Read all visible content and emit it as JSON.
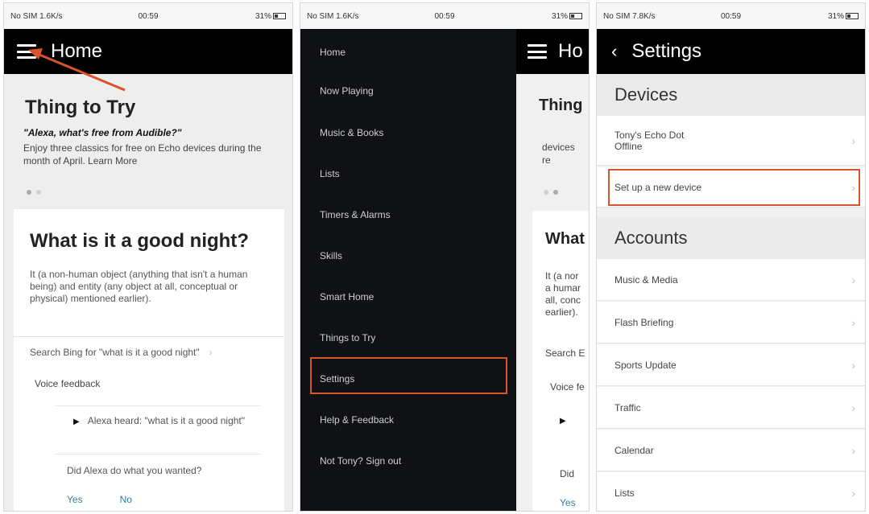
{
  "status": {
    "p1": {
      "carrier": "No SIM 1.6K/s",
      "time": "00:59",
      "battery": "31%"
    },
    "p2": {
      "carrier": "No SIM 1.6K/s",
      "time": "00:59",
      "battery": "31%"
    },
    "p3": {
      "carrier": "No SIM 7.8K/s",
      "time": "00:59",
      "battery": "31%"
    }
  },
  "home": {
    "title": "Home",
    "thing_title": "Thing to Try",
    "thing_quote": "\"Alexa, what's free from Audible?\"",
    "thing_desc": "Enjoy three classics for free on Echo devices during the month of April. Learn More",
    "card_title": "What is it a good night?",
    "card_body": "It (a non-human object (anything that isn't a human being) and entity (any object at all, conceptual or physical) mentioned earlier).",
    "search_text": "Search Bing for \"what is it a good night\"",
    "voice_feedback": "Voice feedback",
    "alexa_heard": "Alexa heard: \"what is it a good night\"",
    "did_alexa": "Did Alexa do what you wanted?",
    "yes": "Yes",
    "no": "No"
  },
  "drawer": {
    "items": [
      "Home",
      "Now Playing",
      "Music & Books",
      "Lists",
      "Timers & Alarms",
      "Skills",
      "Smart Home",
      "Things to Try",
      "Settings",
      "Help & Feedback",
      "Not Tony? Sign out"
    ],
    "peek_title": "Ho",
    "peek_thing": "Thing",
    "peek_devices": "devices",
    "peek_re": "re",
    "peek_what": "What",
    "peek_body": [
      "It (a nor",
      "a humar",
      "all, conc",
      "earlier)."
    ],
    "peek_search": "Search E",
    "peek_voice": "Voice fe",
    "peek_did": "Did",
    "peek_yes": "Yes"
  },
  "settings": {
    "title": "Settings",
    "devices_header": "Devices",
    "device_name": "Tony's Echo Dot",
    "device_status": "Offline",
    "new_device": "Set up a new device",
    "accounts_header": "Accounts",
    "accounts": [
      "Music & Media",
      "Flash Briefing",
      "Sports Update",
      "Traffic",
      "Calendar",
      "Lists"
    ]
  },
  "colors": {
    "appbar": "#000000",
    "highlight": "#d9542b",
    "link": "#2e7fa0",
    "drawer": "#0f1115"
  },
  "icons": [
    "hamburger-icon",
    "back-chevron-icon",
    "chevron-right-icon",
    "arrow-annotation",
    "play-triangle-icon"
  ]
}
